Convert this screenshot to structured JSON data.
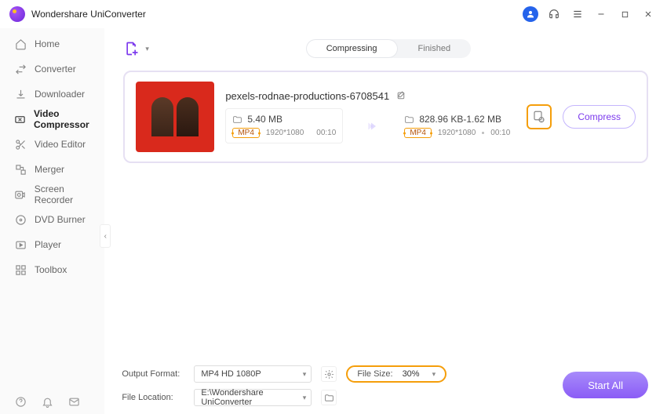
{
  "app": {
    "title": "Wondershare UniConverter"
  },
  "sidebar": {
    "items": [
      {
        "label": "Home"
      },
      {
        "label": "Converter"
      },
      {
        "label": "Downloader"
      },
      {
        "label": "Video Compressor"
      },
      {
        "label": "Video Editor"
      },
      {
        "label": "Merger"
      },
      {
        "label": "Screen Recorder"
      },
      {
        "label": "DVD Burner"
      },
      {
        "label": "Player"
      },
      {
        "label": "Toolbox"
      }
    ]
  },
  "tabs": {
    "compressing": "Compressing",
    "finished": "Finished"
  },
  "file": {
    "name": "pexels-rodnae-productions-6708541",
    "source": {
      "size": "5.40 MB",
      "format": "MP4",
      "resolution": "1920*1080",
      "duration": "00:10"
    },
    "target": {
      "size": "828.96 KB-1.62 MB",
      "format": "MP4",
      "resolution": "1920*1080",
      "duration": "00:10"
    },
    "compress_label": "Compress"
  },
  "bottom": {
    "output_format_label": "Output Format:",
    "output_format_value": "MP4 HD 1080P",
    "file_location_label": "File Location:",
    "file_location_value": "E:\\Wondershare UniConverter",
    "filesize_label": "File Size:",
    "filesize_value": "30%",
    "start_all": "Start All"
  }
}
